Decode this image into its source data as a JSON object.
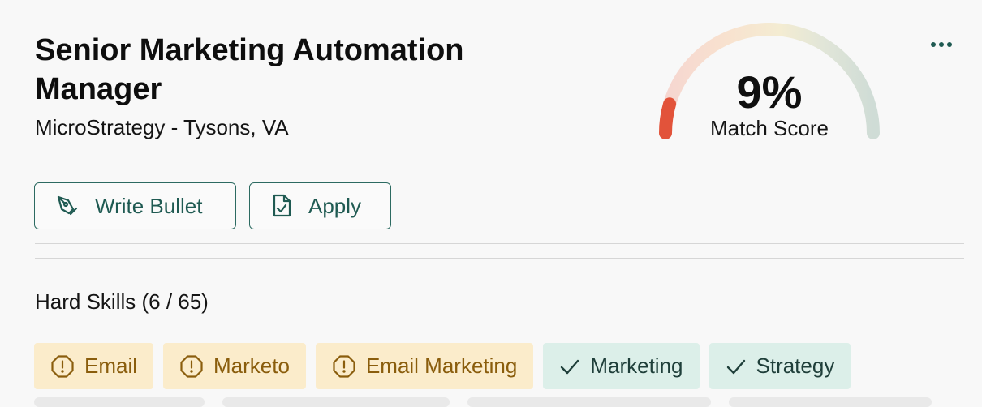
{
  "job": {
    "title": "Senior Marketing Automation Manager",
    "company_location": "MicroStrategy - Tysons, VA"
  },
  "match": {
    "value": "9%",
    "label": "Match Score",
    "fraction": 0.09
  },
  "actions": {
    "write_bullet_label": "Write Bullet",
    "apply_label": "Apply"
  },
  "skills": {
    "heading": "Hard Skills (6 / 65)",
    "chips": [
      {
        "label": "Email",
        "status": "missing",
        "icon": "alert-octagon-icon"
      },
      {
        "label": "Marketo",
        "status": "missing",
        "icon": "alert-octagon-icon"
      },
      {
        "label": "Email Marketing",
        "status": "missing",
        "icon": "alert-octagon-icon"
      },
      {
        "label": "Marketing",
        "status": "matched",
        "icon": "check-icon"
      },
      {
        "label": "Strategy",
        "status": "matched",
        "icon": "check-icon"
      }
    ]
  },
  "colors": {
    "accent": "#1f5a52",
    "missing_bg": "#fbeccb",
    "missing_fg": "#8a5d0c",
    "matched_bg": "#dcefe9",
    "gauge_fill": "#e2533a"
  }
}
